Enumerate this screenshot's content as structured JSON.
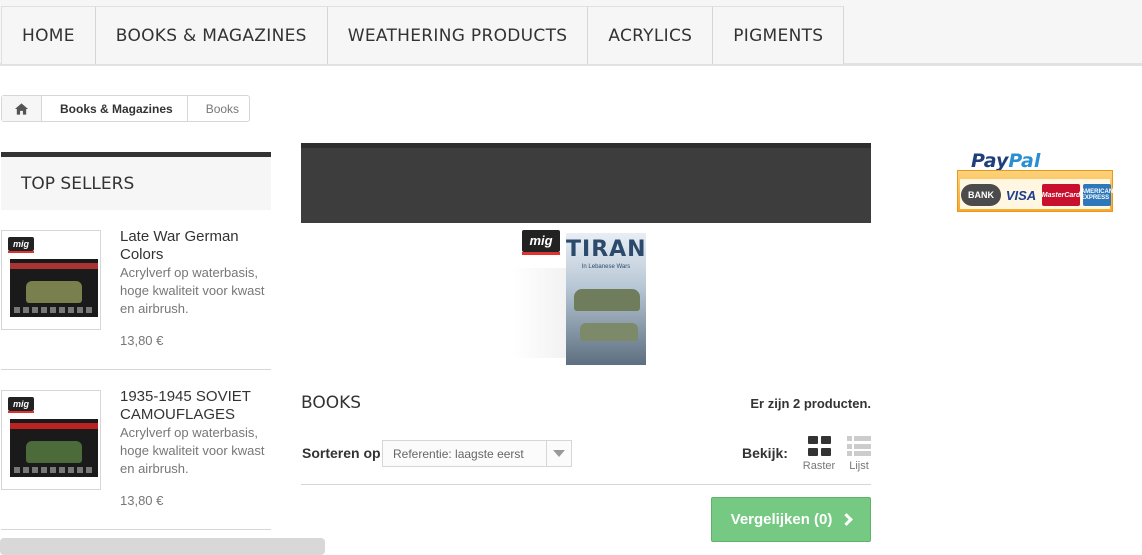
{
  "nav": {
    "items": [
      {
        "label": "HOME"
      },
      {
        "label": "BOOKS & MAGAZINES"
      },
      {
        "label": "WEATHERING PRODUCTS"
      },
      {
        "label": "ACRYLICS"
      },
      {
        "label": "PIGMENTS"
      }
    ]
  },
  "breadcrumb": {
    "home_icon": "home-icon",
    "items": [
      {
        "label": "Books & Magazines"
      },
      {
        "label": "Books"
      }
    ]
  },
  "sidebar": {
    "title": "TOP SELLERS",
    "products": [
      {
        "brand": "mig",
        "title": "Late War German Colors",
        "description": "Acrylverf op waterbasis, hoge kwaliteit voor kwast en airbrush.",
        "price": "13,80 €",
        "tank_color": "#7a7f4e"
      },
      {
        "brand": "mig",
        "title": "1935-1945 SOVIET CAMOUFLAGES",
        "description": "Acrylverf op waterbasis, hoge kwaliteit voor kwast en airbrush.",
        "price": "13,80 €",
        "tank_color": "#4d6b3a"
      }
    ]
  },
  "category": {
    "cover_brand": "mig",
    "cover_title": "TIRAN",
    "cover_subtitle": "In Lebanese Wars",
    "heading": "BOOKS",
    "count_text": "Er zijn 2 producten.",
    "sort_label": "Sorteren op",
    "sort_value": "Referentie: laagste eerst",
    "view_label": "Bekijk:",
    "view_grid_label": "Raster",
    "view_list_label": "Lijst",
    "compare_label": "Vergelijken (0)"
  },
  "payment": {
    "paypal_pay": "Pay",
    "paypal_pal": "Pal",
    "cards": [
      "BANK",
      "VISA",
      "MasterCard",
      "AMERICAN EXPRESS"
    ]
  },
  "colors": {
    "accent_green": "#76c983",
    "dark_banner": "#3d3d3d",
    "nav_bg": "#f6f6f6"
  }
}
